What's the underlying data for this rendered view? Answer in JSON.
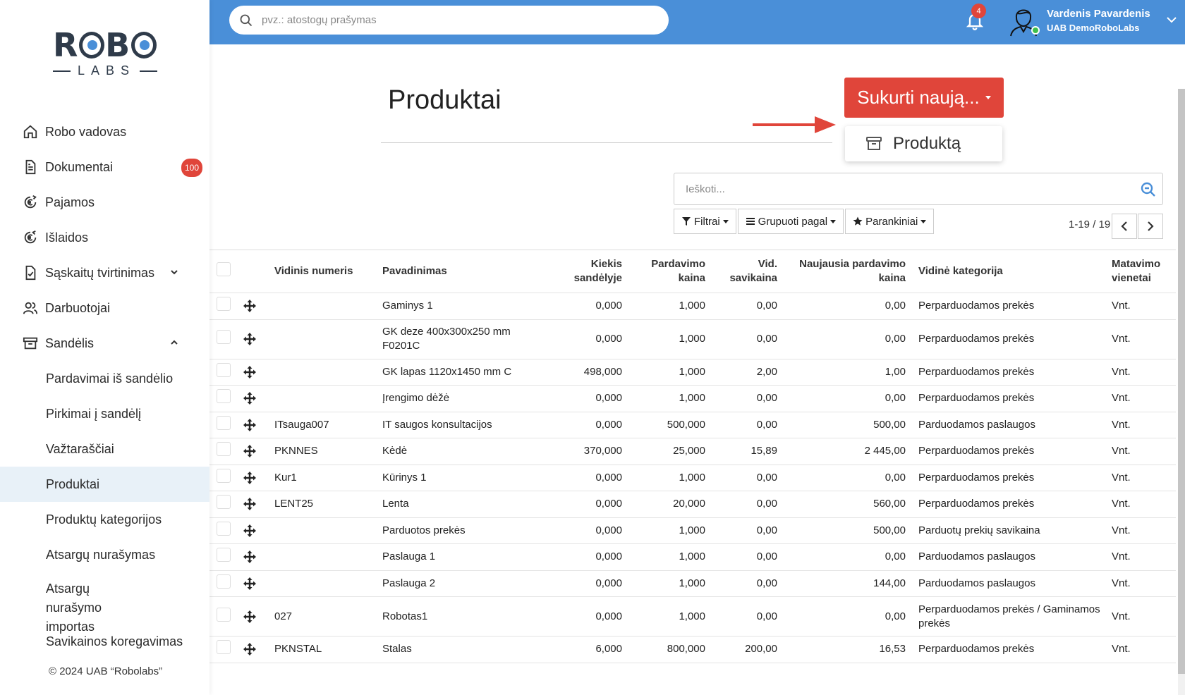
{
  "brand": {
    "logo_top": "ROBO",
    "logo_bottom": "LABS"
  },
  "sidebar": {
    "items": [
      {
        "label": "Robo vadovas",
        "icon": "home-icon"
      },
      {
        "label": "Dokumentai",
        "icon": "document-icon",
        "badge": "100"
      },
      {
        "label": "Pajamos",
        "icon": "euro-income-icon"
      },
      {
        "label": "Išlaidos",
        "icon": "euro-expense-icon"
      },
      {
        "label": "Sąskaitų tvirtinimas",
        "icon": "invoice-check-icon",
        "expanded": false
      },
      {
        "label": "Darbuotojai",
        "icon": "users-icon"
      },
      {
        "label": "Sandėlis",
        "icon": "archive-icon",
        "expanded": true
      }
    ],
    "subitems": [
      {
        "label": "Pardavimai iš sandėlio"
      },
      {
        "label": "Pirkimai į sandėlį"
      },
      {
        "label": "Važtaraščiai"
      },
      {
        "label": "Produktai",
        "active": true
      },
      {
        "label": "Produktų kategorijos"
      },
      {
        "label": "Atsargų nurašymas"
      },
      {
        "label": "Atsargų nurašymo importas"
      },
      {
        "label": "Savikainos koregavimas"
      }
    ],
    "footer": "© 2024 UAB “Robolabs”"
  },
  "header": {
    "search_placeholder": "pvz.: atostogų prašymas",
    "notifications_count": "4",
    "user_name": "Vardenis Pavardenis",
    "user_company": "UAB DemoRoboLabs"
  },
  "main": {
    "title": "Produktai",
    "create_label": "Sukurti naują...",
    "dropdown_item": "Produktą",
    "search_placeholder": "Ieškoti...",
    "filters_label": "Filtrai",
    "group_label": "Grupuoti pagal",
    "favorites_label": "Parankiniai",
    "pager": "1-19 / 19"
  },
  "colors": {
    "accent": "#4a8fd8",
    "danger": "#e0453a",
    "active_bg": "#e8f1f8"
  },
  "table": {
    "headers": {
      "internal_no": "Vidinis numeris",
      "name": "Pavadinimas",
      "qty": "Kiekis sandėlyje",
      "price": "Pardavimo kaina",
      "cost": "Vid. savikaina",
      "latest_price": "Naujausia pardavimo kaina",
      "category": "Vidinė kategorija",
      "unit": "Matavimo vienetai"
    },
    "rows": [
      {
        "num": "",
        "name": "Gaminys 1",
        "qty": "0,000",
        "price": "1,000",
        "cost": "0,00",
        "latest": "0,00",
        "cat": "Perparduodamos prekės",
        "unit": "Vnt."
      },
      {
        "num": "",
        "name": "GK deze 400x300x250 mm F0201C",
        "qty": "0,000",
        "price": "1,000",
        "cost": "0,00",
        "latest": "0,00",
        "cat": "Perparduodamos prekės",
        "unit": "Vnt."
      },
      {
        "num": "",
        "name": "GK lapas 1120x1450 mm C",
        "qty": "498,000",
        "price": "1,000",
        "cost": "2,00",
        "latest": "1,00",
        "cat": "Perparduodamos prekės",
        "unit": "Vnt."
      },
      {
        "num": "",
        "name": "Įrengimo dėžė",
        "qty": "0,000",
        "price": "1,000",
        "cost": "0,00",
        "latest": "0,00",
        "cat": "Perparduodamos prekės",
        "unit": "Vnt."
      },
      {
        "num": "ITsauga007",
        "name": "IT saugos konsultacijos",
        "qty": "0,000",
        "price": "500,000",
        "cost": "0,00",
        "latest": "500,00",
        "cat": "Parduodamos paslaugos",
        "unit": "Vnt."
      },
      {
        "num": "PKNNES",
        "name": "Kėdė",
        "qty": "370,000",
        "price": "25,000",
        "cost": "15,89",
        "latest": "2 445,00",
        "cat": "Perparduodamos prekės",
        "unit": "Vnt."
      },
      {
        "num": "Kur1",
        "name": "Kūrinys 1",
        "qty": "0,000",
        "price": "1,000",
        "cost": "0,00",
        "latest": "0,00",
        "cat": "Perparduodamos prekės",
        "unit": "Vnt."
      },
      {
        "num": "LENT25",
        "name": "Lenta",
        "qty": "0,000",
        "price": "20,000",
        "cost": "0,00",
        "latest": "560,00",
        "cat": "Perparduodamos prekės",
        "unit": "Vnt."
      },
      {
        "num": "",
        "name": "Parduotos prekės",
        "qty": "0,000",
        "price": "1,000",
        "cost": "0,00",
        "latest": "500,00",
        "cat": "Parduotų prekių savikaina",
        "unit": "Vnt."
      },
      {
        "num": "",
        "name": "Paslauga 1",
        "qty": "0,000",
        "price": "1,000",
        "cost": "0,00",
        "latest": "0,00",
        "cat": "Parduodamos paslaugos",
        "unit": "Vnt."
      },
      {
        "num": "",
        "name": "Paslauga 2",
        "qty": "0,000",
        "price": "1,000",
        "cost": "0,00",
        "latest": "144,00",
        "cat": "Parduodamos paslaugos",
        "unit": "Vnt."
      },
      {
        "num": "027",
        "name": "Robotas1",
        "qty": "0,000",
        "price": "1,000",
        "cost": "0,00",
        "latest": "0,00",
        "cat": "Perparduodamos prekės / Gaminamos prekės",
        "unit": "Vnt."
      },
      {
        "num": "PKNSTAL",
        "name": "Stalas",
        "qty": "6,000",
        "price": "800,000",
        "cost": "200,00",
        "latest": "16,53",
        "cat": "Perparduodamos prekės",
        "unit": "Vnt."
      }
    ]
  }
}
